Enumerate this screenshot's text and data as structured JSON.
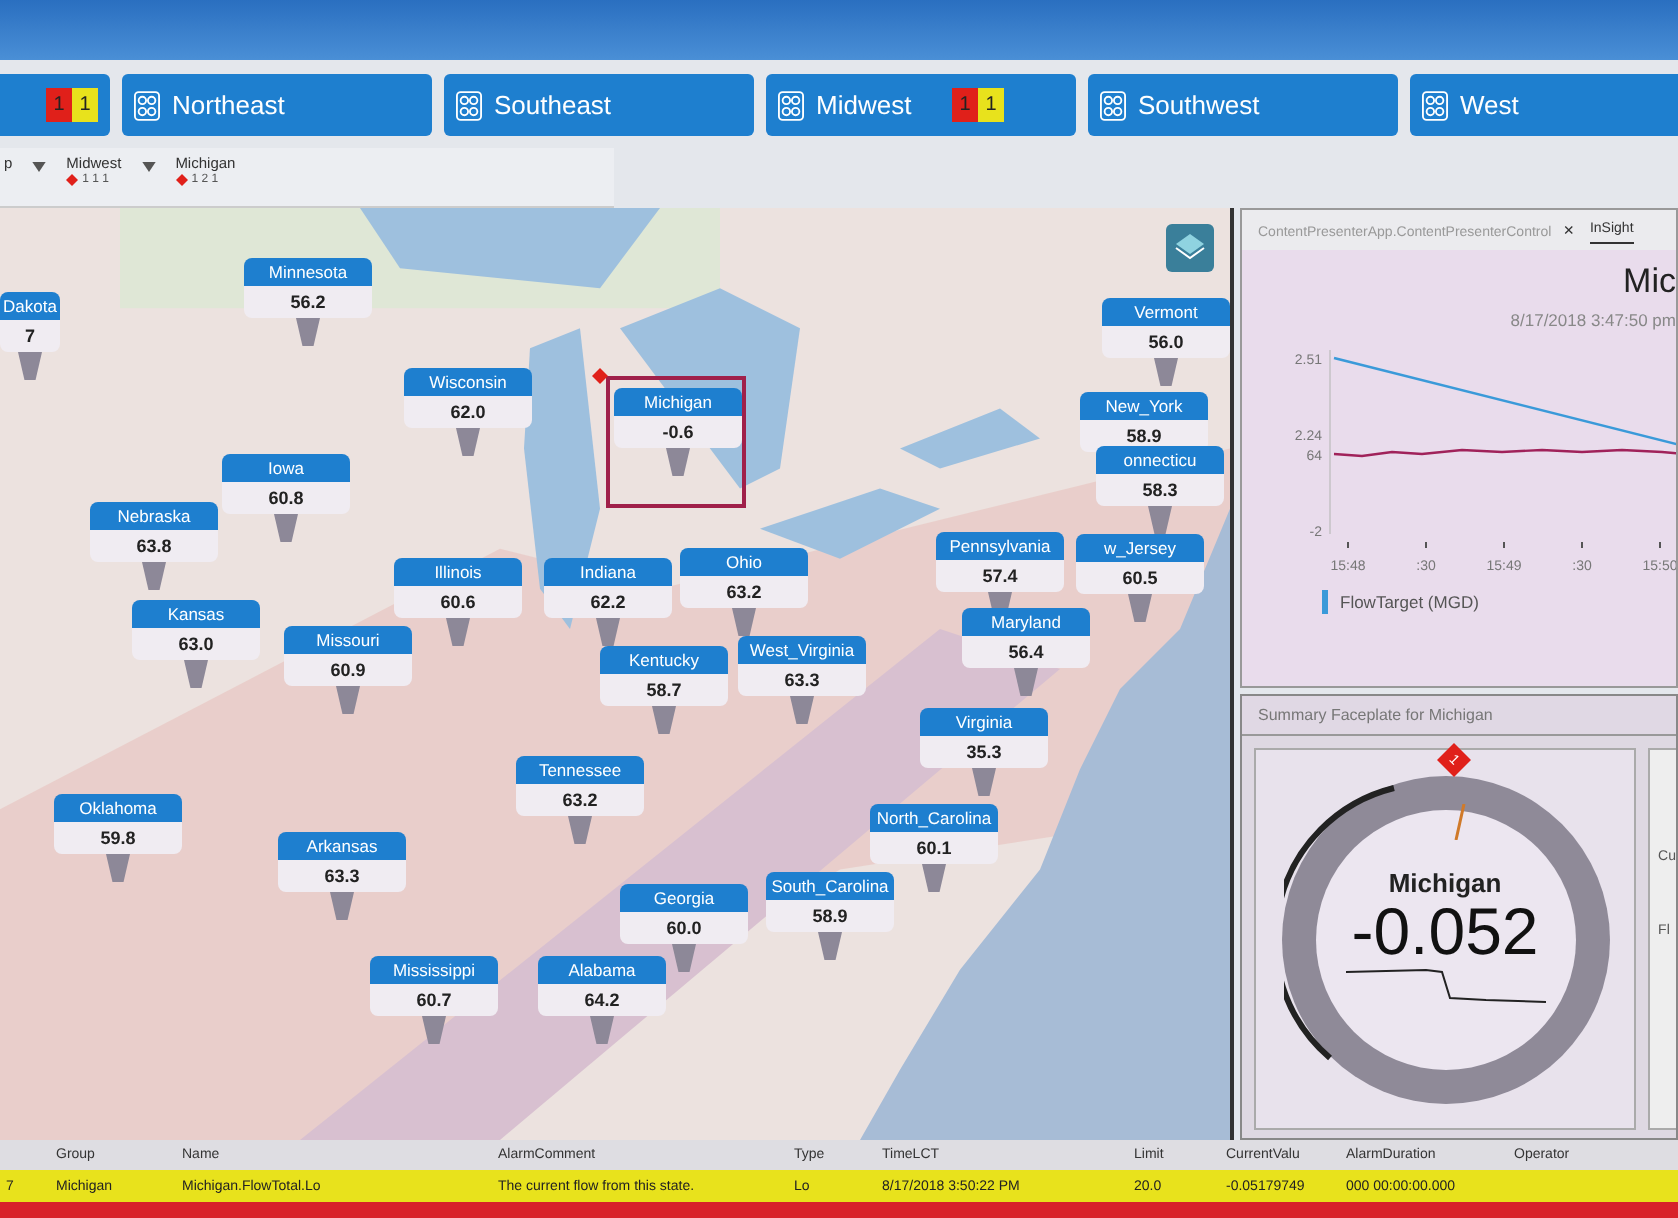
{
  "region_tabs": [
    {
      "badges": [
        {
          "text": "1",
          "color": "#e0201a"
        },
        {
          "text": "1",
          "color": "#e8e21c"
        }
      ]
    },
    {
      "label": "Northeast"
    },
    {
      "label": "Southeast"
    },
    {
      "label": "Midwest",
      "badges": [
        {
          "text": "1",
          "color": "#e0201a"
        },
        {
          "text": "1",
          "color": "#e8e21c"
        }
      ]
    },
    {
      "label": "Southwest"
    },
    {
      "label": "West"
    }
  ],
  "breadcrumb": [
    {
      "label": "p"
    },
    {
      "label": "Midwest",
      "counts": [
        "1",
        "1",
        "1"
      ]
    },
    {
      "label": "Michigan",
      "counts": [
        "1",
        "2",
        "1"
      ]
    }
  ],
  "map": {
    "pins": [
      {
        "name": "Dakota",
        "value": "7",
        "selected": false,
        "alarm": false
      },
      {
        "name": "Minnesota",
        "value": "56.2",
        "selected": false,
        "alarm": false
      },
      {
        "name": "Wisconsin",
        "value": "62.0",
        "selected": false,
        "alarm": false
      },
      {
        "name": "Michigan",
        "value": "-0.6",
        "selected": true,
        "alarm": true
      },
      {
        "name": "Iowa",
        "value": "60.8",
        "selected": false,
        "alarm": false
      },
      {
        "name": "Nebraska",
        "value": "63.8",
        "selected": false,
        "alarm": false
      },
      {
        "name": "Kansas",
        "value": "63.0",
        "selected": false,
        "alarm": false
      },
      {
        "name": "Missouri",
        "value": "60.9",
        "selected": false,
        "alarm": false
      },
      {
        "name": "Illinois",
        "value": "60.6",
        "selected": false,
        "alarm": false
      },
      {
        "name": "Indiana",
        "value": "62.2",
        "selected": false,
        "alarm": false
      },
      {
        "name": "Ohio",
        "value": "63.2",
        "selected": false,
        "alarm": false
      },
      {
        "name": "Kentucky",
        "value": "58.7",
        "selected": false,
        "alarm": false
      },
      {
        "name": "West_Virginia",
        "value": "63.3",
        "selected": false,
        "alarm": false
      },
      {
        "name": "Vermont",
        "value": "56.0",
        "selected": false,
        "alarm": false
      },
      {
        "name": "New_York",
        "value": "58.9",
        "selected": false,
        "alarm": false
      },
      {
        "name": "onnecticu",
        "value": "58.3",
        "selected": false,
        "alarm": false
      },
      {
        "name": "Pennsylvania",
        "value": "57.4",
        "selected": false,
        "alarm": false
      },
      {
        "name": "w_Jersey",
        "value": "60.5",
        "selected": false,
        "alarm": false
      },
      {
        "name": "Maryland",
        "value": "56.4",
        "selected": false,
        "alarm": false
      },
      {
        "name": "Virginia",
        "value": "35.3",
        "selected": false,
        "alarm": false
      },
      {
        "name": "Tennessee",
        "value": "63.2",
        "selected": false,
        "alarm": false
      },
      {
        "name": "North_Carolina",
        "value": "60.1",
        "selected": false,
        "alarm": false
      },
      {
        "name": "Oklahoma",
        "value": "59.8",
        "selected": false,
        "alarm": false
      },
      {
        "name": "Arkansas",
        "value": "63.3",
        "selected": false,
        "alarm": false
      },
      {
        "name": "Georgia",
        "value": "60.0",
        "selected": false,
        "alarm": false
      },
      {
        "name": "South_Carolina",
        "value": "58.9",
        "selected": false,
        "alarm": false
      },
      {
        "name": "Mississippi",
        "value": "60.7",
        "selected": false,
        "alarm": false
      },
      {
        "name": "Alabama",
        "value": "64.2",
        "selected": false,
        "alarm": false
      }
    ]
  },
  "trend_panel": {
    "tabs": [
      {
        "label": "ContentPresenterApp.ContentPresenterControl",
        "close": "×",
        "selected": false
      },
      {
        "label": "InSight",
        "selected": true
      }
    ],
    "title": "Mic",
    "timestamp": "8/17/2018 3:47:50 pm",
    "y_labels": [
      "2.51",
      "2.24",
      "64",
      "-2"
    ],
    "x_labels": [
      "15:48",
      ":30",
      "15:49",
      ":30",
      "15:50"
    ],
    "legend": {
      "label": "FlowTarget (MGD)",
      "color": "#3a9ad9"
    }
  },
  "faceplate": {
    "title": "Summary Faceplate for  Michigan",
    "alarm_count": "1",
    "name": "Michigan",
    "value": "-0.052",
    "side_labels": [
      "Cu",
      "Fl"
    ]
  },
  "alarm_table": {
    "columns": [
      "",
      "Group",
      "Name",
      "AlarmComment",
      "Type",
      "TimeLCT",
      "Limit",
      "CurrentValu",
      "AlarmDuration",
      "Operator"
    ],
    "rows": [
      {
        "color": "#e8e21c",
        "cells": [
          "7",
          "Michigan",
          "Michigan.FlowTotal.Lo",
          "The current flow from this state.",
          "Lo",
          "8/17/2018 3:50:22 PM",
          "20.0",
          "-0.05179749",
          "000 00:00:00.000"
        ]
      },
      {
        "color": "#d8222a"
      }
    ]
  }
}
